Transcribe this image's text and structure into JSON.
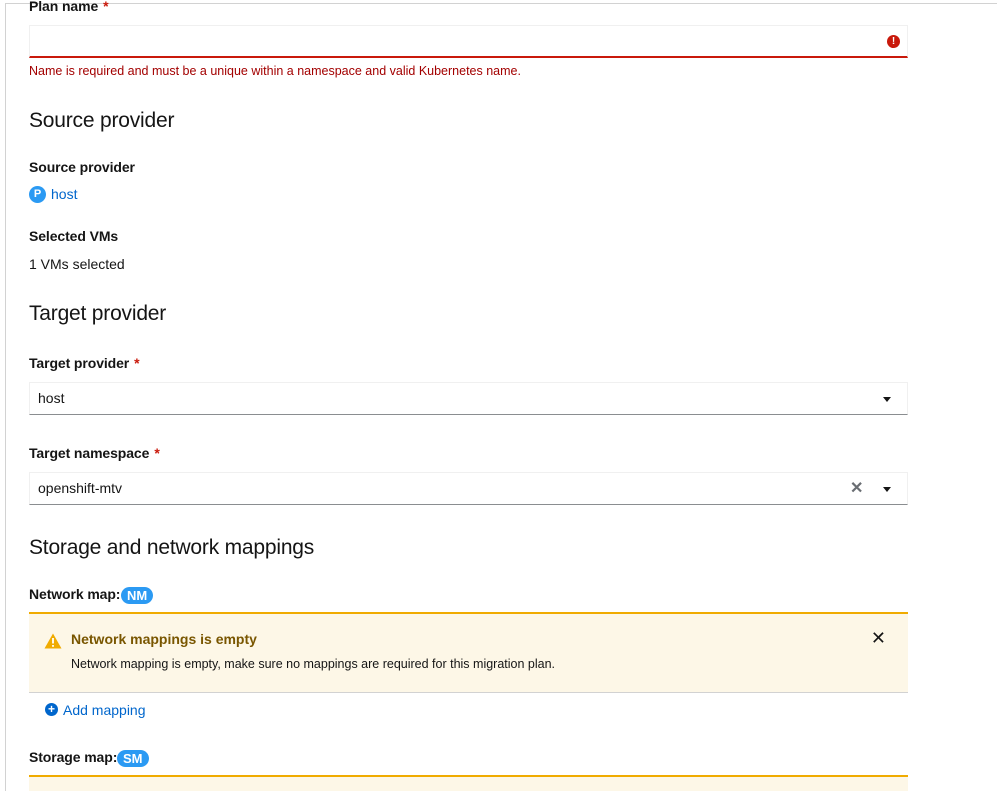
{
  "plan_name": {
    "label": "Plan name",
    "required_mark": "*",
    "value": "",
    "error_icon": "exclamation-circle-icon",
    "error_message": "Name is required and must be a unique within a namespace and valid Kubernetes name."
  },
  "source_section": {
    "heading": "Source provider",
    "provider_label": "Source provider",
    "provider_badge": "P",
    "provider_name": "host",
    "selected_vms_label": "Selected VMs",
    "selected_vms_value": "1 VMs selected"
  },
  "target_section": {
    "heading": "Target provider",
    "provider_label": "Target provider",
    "provider_required": "*",
    "provider_value": "host",
    "namespace_label": "Target namespace",
    "namespace_required": "*",
    "namespace_value": "openshift-mtv",
    "clear_glyph": "✕"
  },
  "mappings_section": {
    "heading": "Storage and network mappings",
    "network_map_label": "Network map:",
    "network_map_badge": "NM",
    "network_alert": {
      "icon": "warning-triangle-icon",
      "title": "Network mappings is empty",
      "body": "Network mapping is empty, make sure no mappings are required for this migration plan.",
      "close_glyph": "✕"
    },
    "add_mapping_label": "Add mapping",
    "storage_map_label": "Storage map:",
    "storage_map_badge": "SM"
  },
  "colors": {
    "error": "#c9190b",
    "link": "#0066cc",
    "badge": "#2b9af3",
    "warning": "#f0ab00",
    "warning_bg": "#fdf7e7",
    "warning_title": "#795600"
  }
}
